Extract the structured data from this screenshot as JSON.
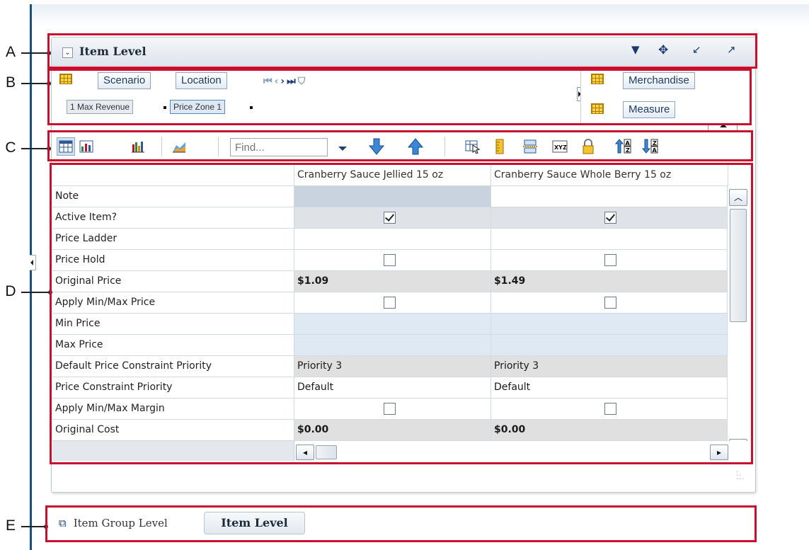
{
  "annotations": [
    "A",
    "B",
    "C",
    "D",
    "E"
  ],
  "panel": {
    "title": "Item Level"
  },
  "pivot": {
    "row_tiles": [
      "Scenario",
      "Location"
    ],
    "chips": [
      "1 Max Revenue",
      "Price Zone 1"
    ],
    "column_tiles": [
      "Merchandise",
      "Measure"
    ]
  },
  "toolbar": {
    "find_placeholder": "Find..."
  },
  "grid": {
    "columns": [
      "Cranberry Sauce Jellied 15 oz",
      "Cranberry Sauce Whole Berry 15 oz"
    ],
    "rows": [
      {
        "label": "Note",
        "a": "",
        "b": ""
      },
      {
        "label": "Active Item?",
        "a": "checked",
        "b": "checked"
      },
      {
        "label": "Price Ladder",
        "a": "",
        "b": ""
      },
      {
        "label": "Price Hold",
        "a": "unchecked",
        "b": "unchecked"
      },
      {
        "label": "Original Price",
        "a": "$1.09",
        "b": "$1.49"
      },
      {
        "label": "Apply Min/Max Price",
        "a": "unchecked",
        "b": "unchecked"
      },
      {
        "label": "Min Price",
        "a": "",
        "b": ""
      },
      {
        "label": "Max Price",
        "a": "",
        "b": ""
      },
      {
        "label": "Default Price Constraint Priority",
        "a": "Priority 3",
        "b": "Priority 3"
      },
      {
        "label": "Price Constraint Priority",
        "a": "Default",
        "b": "Default"
      },
      {
        "label": "Apply Min/Max Margin",
        "a": "unchecked",
        "b": "unchecked"
      },
      {
        "label": "Original Cost",
        "a": "$0.00",
        "b": "$0.00"
      }
    ]
  },
  "bottom_tabs": {
    "inactive": "Item Group Level",
    "active": "Item Level"
  },
  "colors": {
    "annotation_box": "#c8102e",
    "frame": "#1c4e80",
    "accent": "#1c3e78"
  }
}
